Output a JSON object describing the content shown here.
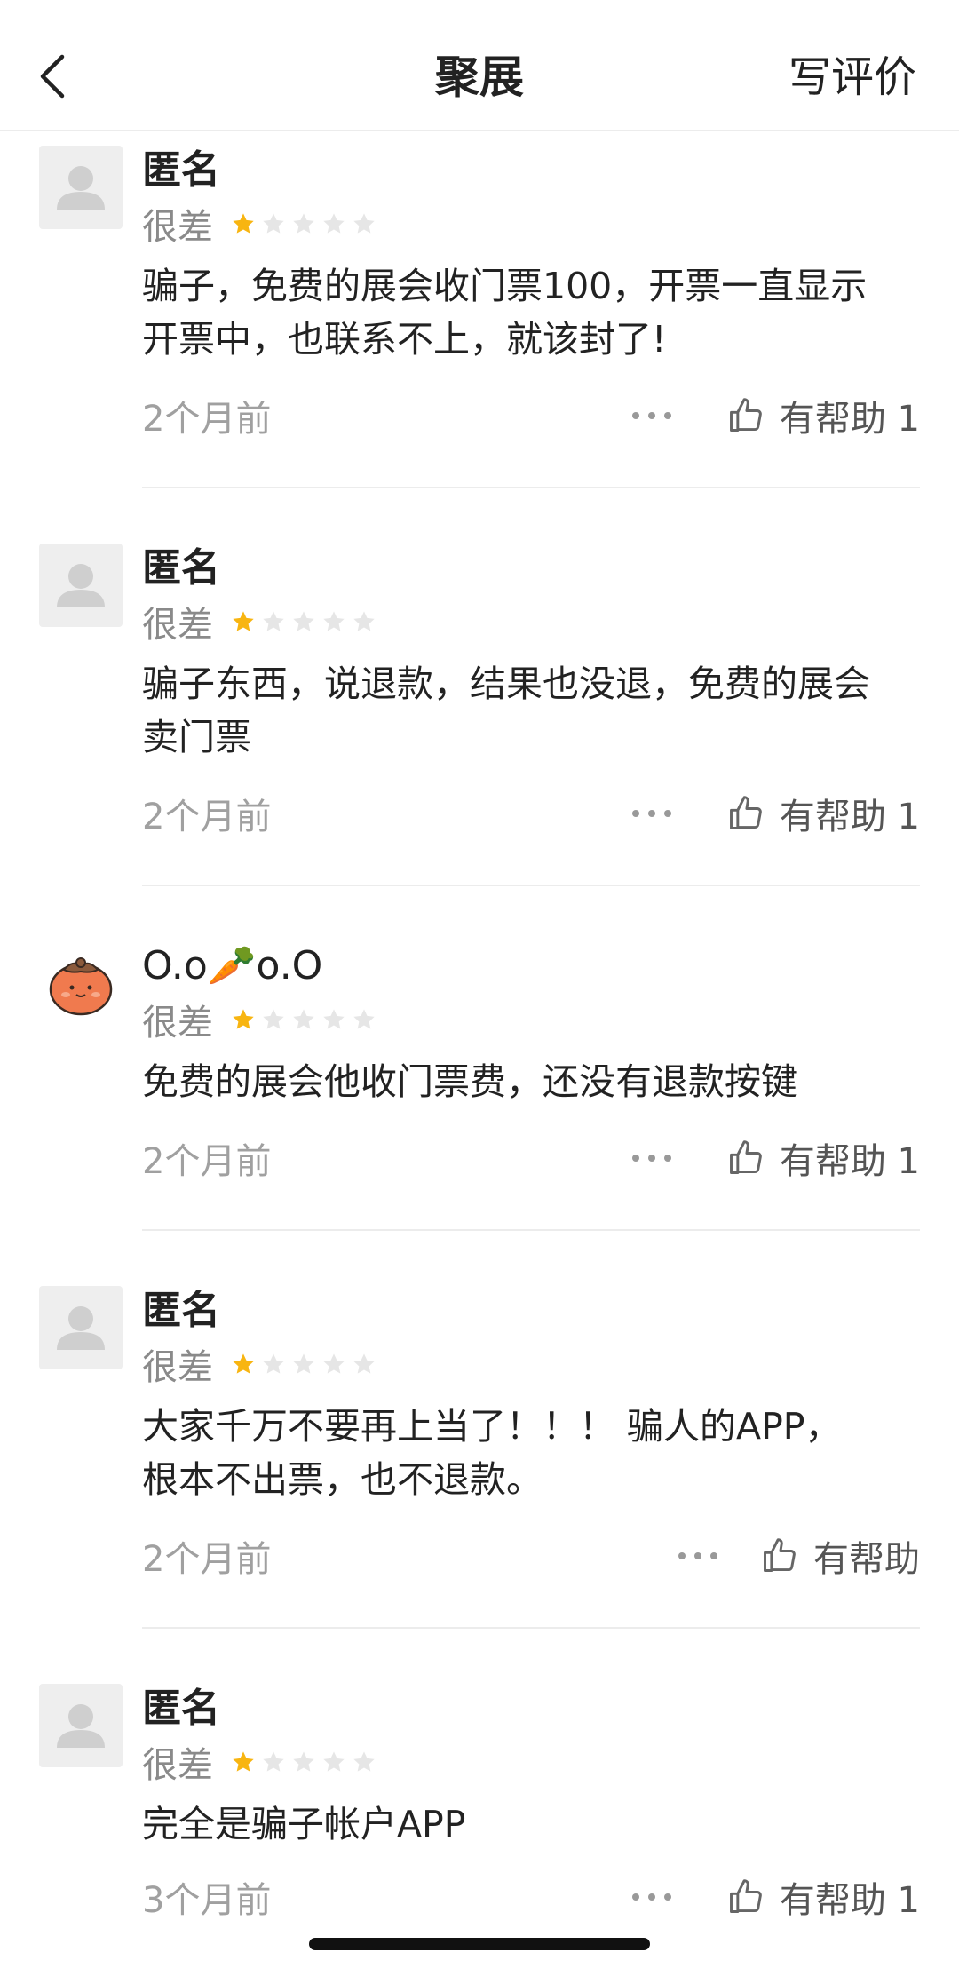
{
  "header": {
    "title": "聚展",
    "write_review": "写评价"
  },
  "reviews": [
    {
      "name": "匿名",
      "rating_label": "很差",
      "rating": 1,
      "content": "骗子，免费的展会收门票100，开票一直显示\n开票中，也联系不上，就该封了!",
      "time": "2个月前",
      "helpful": "有帮助 1"
    },
    {
      "name": "匿名",
      "rating_label": "很差",
      "rating": 1,
      "content": "骗子东西，说退款，结果也没退，免费的展会\n卖门票",
      "time": "2个月前",
      "helpful": "有帮助 1"
    },
    {
      "name": "O.o🥕o.O",
      "rating_label": "很差",
      "rating": 1,
      "content": "免费的展会他收门票费，还没有退款按键",
      "time": "2个月前",
      "helpful": "有帮助 1"
    },
    {
      "name": "匿名",
      "rating_label": "很差",
      "rating": 1,
      "content": "大家千万不要再上当了！！！ 骗人的APP，\n根本不出票，也不退款。",
      "time": "2个月前",
      "helpful": "有帮助"
    },
    {
      "name": "匿名",
      "rating_label": "很差",
      "rating": 1,
      "content": "完全是骗子帐户APP",
      "time": "3个月前",
      "helpful": "有帮助 1"
    }
  ],
  "colors": {
    "star_filled": "#F8B511",
    "star_empty": "#E6E6E6",
    "muted_text": "#A0A0A0"
  },
  "icons": {
    "back": "chevron-left-icon",
    "more": "more-dots-icon",
    "helpful": "thumbs-up-icon",
    "avatar_default": "default-avatar-icon"
  }
}
